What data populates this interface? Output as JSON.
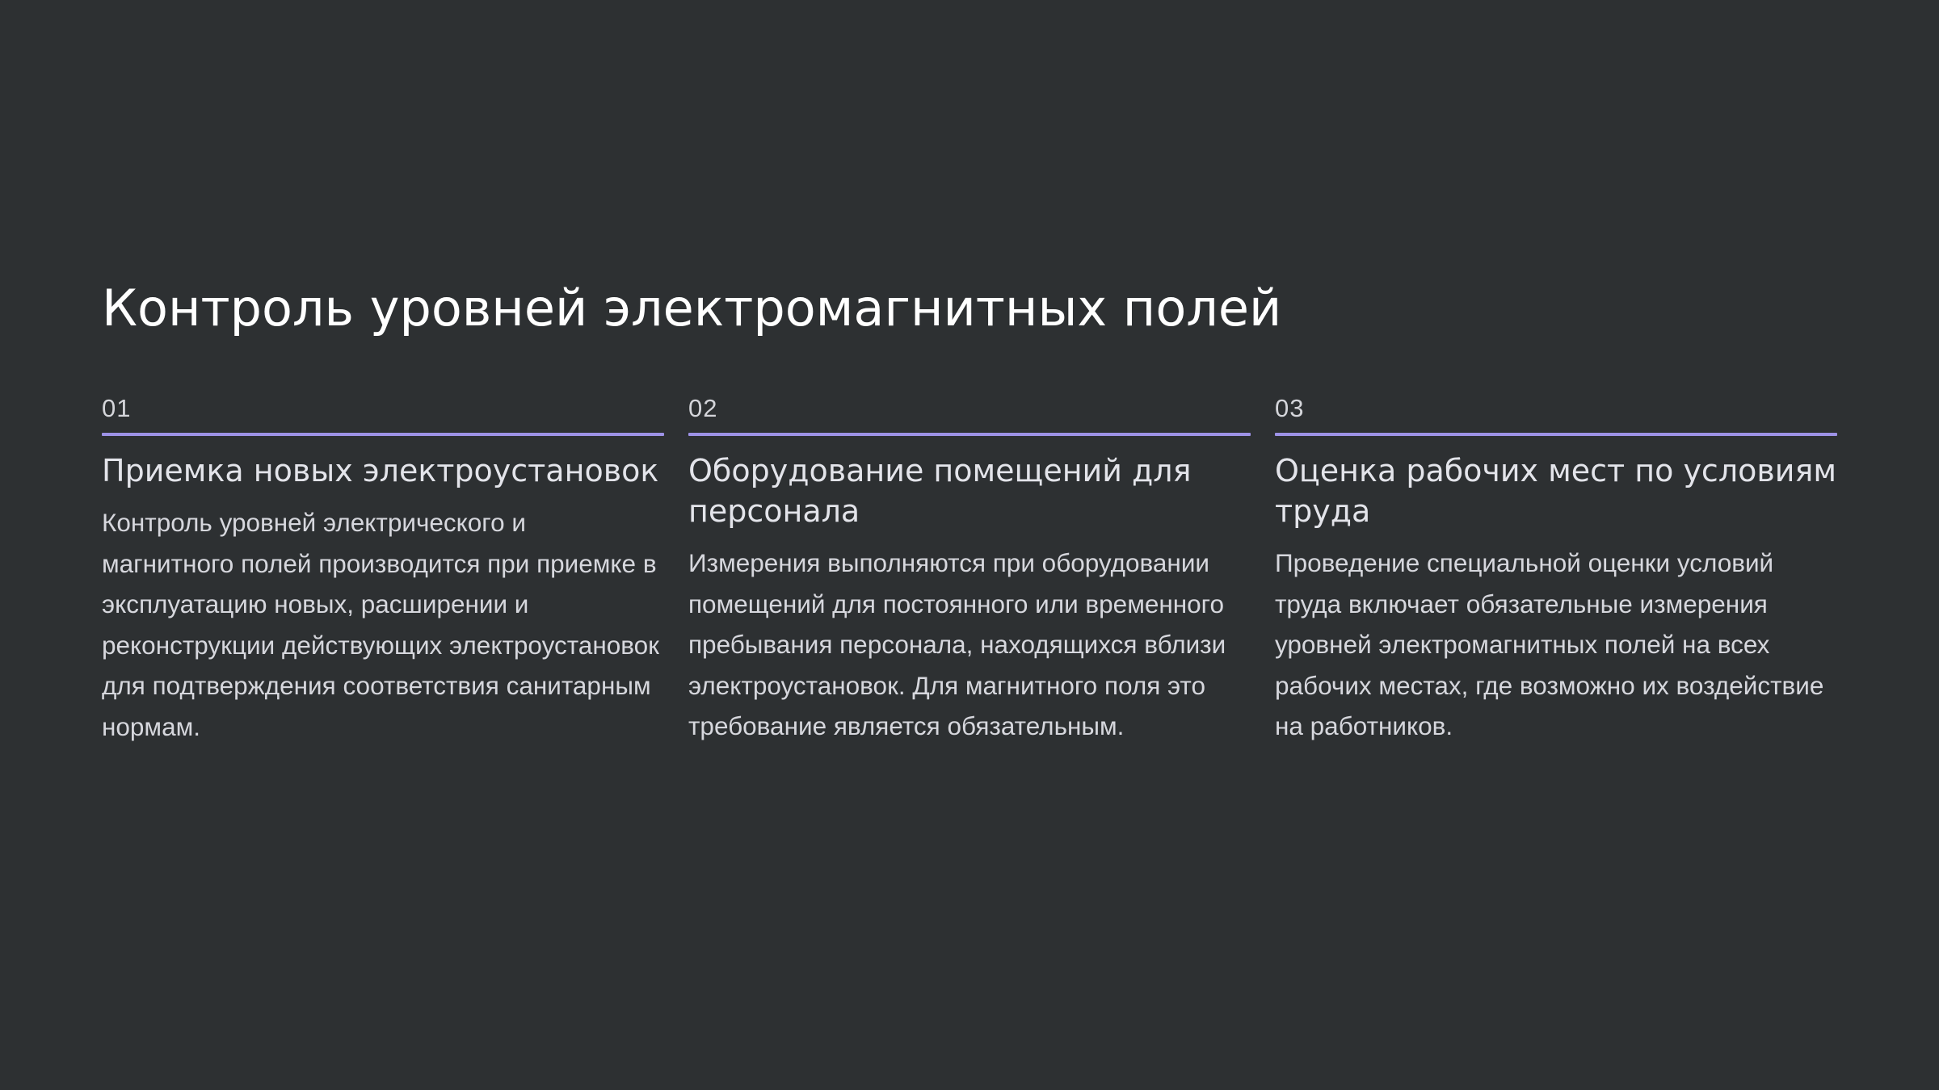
{
  "slide": {
    "title": "Контроль уровней электромагнитных полей",
    "accent_color": "#9d92e6",
    "background_color": "#2d3032",
    "items": [
      {
        "number": "01",
        "heading": "Приемка новых электроустановок",
        "text": "Контроль уровней электрического и магнитного полей производится при приемке в эксплуатацию новых, расширении и реконструкции действующих электроустановок для подтверждения соответствия санитарным нормам."
      },
      {
        "number": "02",
        "heading": "Оборудование помещений для персонала",
        "text": "Измерения выполняются при оборудовании помещений для постоянного или временного пребывания персонала, находящихся вблизи электроустановок. Для магнитного поля это требование является обязательным."
      },
      {
        "number": "03",
        "heading": "Оценка рабочих мест по условиям труда",
        "text": "Проведение специальной оценки условий труда включает обязательные измерения уровней электромагнитных полей на всех рабочих местах, где возможно их воздействие на работников."
      }
    ]
  }
}
